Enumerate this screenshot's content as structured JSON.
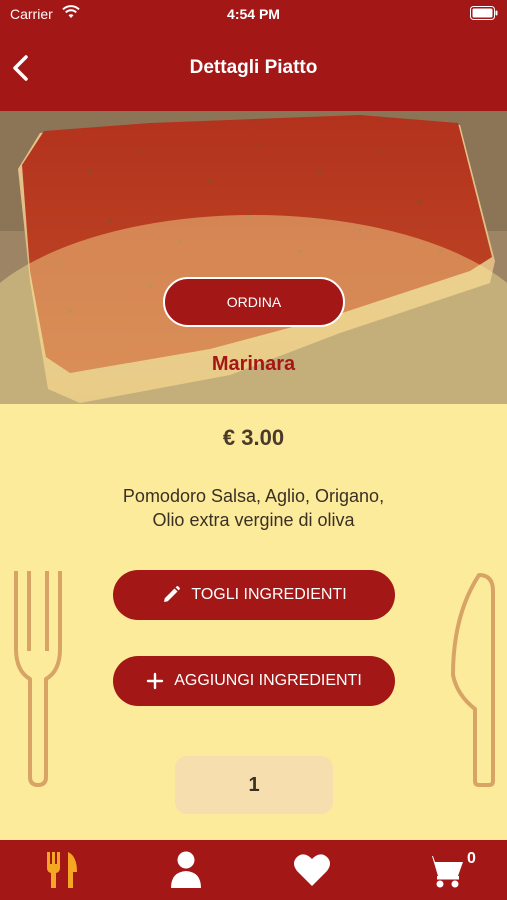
{
  "status_bar": {
    "carrier": "Carrier",
    "time": "4:54 PM"
  },
  "nav": {
    "title": "Dettagli Piatto",
    "back_icon": "chevron-left-icon"
  },
  "hero": {
    "order_label": "ORDINA",
    "dish_name": "Marinara"
  },
  "details": {
    "price": "€ 3.00",
    "ingredients": "Pomodoro Salsa, Aglio, Origano, Olio extra vergine di oliva",
    "remove_label": "TOGLI INGREDIENTI",
    "add_label": "AGGIUNGI INGREDIENTI",
    "quantity": "1"
  },
  "tabbar": {
    "items": [
      {
        "icon": "fork-knife-icon",
        "active": true
      },
      {
        "icon": "user-icon",
        "active": false
      },
      {
        "icon": "heart-icon",
        "active": false
      },
      {
        "icon": "cart-icon",
        "active": false
      }
    ],
    "cart_count": "0"
  },
  "colors": {
    "primary": "#a31717",
    "background": "#fdeb9c",
    "cutlery": "#d8a465",
    "active_tab": "#f5a623"
  }
}
